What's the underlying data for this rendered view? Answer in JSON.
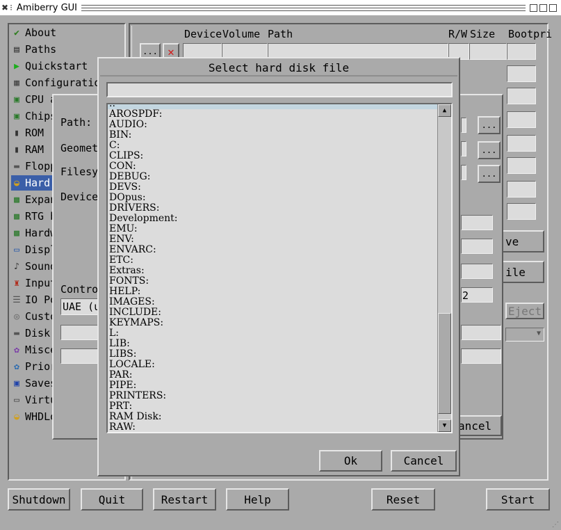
{
  "window": {
    "title": "Amiberry GUI"
  },
  "sidebar": {
    "items": [
      {
        "label": "About",
        "icon": "checkmark-icon"
      },
      {
        "label": "Paths",
        "icon": "paths-icon"
      },
      {
        "label": "Quickstart",
        "icon": "play-icon"
      },
      {
        "label": "Configurations",
        "icon": "config-icon"
      },
      {
        "label": "CPU and FPU",
        "icon": "cpu-icon"
      },
      {
        "label": "Chipset",
        "icon": "chip-icon"
      },
      {
        "label": "ROM",
        "icon": "rom-icon"
      },
      {
        "label": "RAM",
        "icon": "ram-icon"
      },
      {
        "label": "Floppy drives",
        "icon": "floppy-icon"
      },
      {
        "label": "Hard drives/CD",
        "icon": "harddrive-icon"
      },
      {
        "label": "Expansions",
        "icon": "expansion-icon"
      },
      {
        "label": "RTG board",
        "icon": "rtg-icon"
      },
      {
        "label": "Hardware info",
        "icon": "hardware-icon"
      },
      {
        "label": "Display",
        "icon": "display-icon"
      },
      {
        "label": "Sound",
        "icon": "sound-icon"
      },
      {
        "label": "Input",
        "icon": "joystick-icon"
      },
      {
        "label": "IO Ports",
        "icon": "ioports-icon"
      },
      {
        "label": "Custom controls",
        "icon": "gamepad-icon"
      },
      {
        "label": "Disk swapper",
        "icon": "disk-icon"
      },
      {
        "label": "Miscellaneous",
        "icon": "misc-icon"
      },
      {
        "label": "Priority",
        "icon": "priority-icon"
      },
      {
        "label": "Savestates",
        "icon": "save-icon"
      },
      {
        "label": "Virtual Keyboard",
        "icon": "keyboard-icon"
      },
      {
        "label": "WHDLoad",
        "icon": "whdload-icon"
      }
    ],
    "selected_index": 9
  },
  "main": {
    "columns": [
      "Device",
      "Volume",
      "Path",
      "R/W",
      "Size",
      "Bootpri"
    ],
    "row_buttons": {
      "ellipsis": "...",
      "delete": "✕"
    },
    "eject_label": "Eject",
    "save_label": "ve",
    "file_label": "ile"
  },
  "hardfile_dialog": {
    "path_label": "Path:",
    "geometry_label": "Geometr",
    "filesys_label": "Filesys",
    "device_label": "Device:",
    "controller_label": "Control",
    "controller_value": "UAE (u",
    "value_2": "2",
    "ellipsis": "...",
    "cancel_label": "ancel"
  },
  "file_dialog": {
    "title": "Select hard disk file",
    "path_value": "",
    "items": [
      "..",
      "AROSPDF:",
      "AUDIO:",
      "BIN:",
      "C:",
      "CLIPS:",
      "CON:",
      "DEBUG:",
      "DEVS:",
      "DOpus:",
      "DRIVERS:",
      "Development:",
      "EMU:",
      "ENV:",
      "ENVARC:",
      "ETC:",
      "Extras:",
      "FONTS:",
      "HELP:",
      "IMAGES:",
      "INCLUDE:",
      "KEYMAPS:",
      "L:",
      "LIB:",
      "LIBS:",
      "LOCALE:",
      "PAR:",
      "PIPE:",
      "PRINTERS:",
      "PRT:",
      "RAM Disk:",
      "RAW:"
    ],
    "ok_label": "Ok",
    "cancel_label": "Cancel"
  },
  "bottom_bar": {
    "shutdown": "Shutdown",
    "quit": "Quit",
    "restart": "Restart",
    "help": "Help",
    "reset": "Reset",
    "start": "Start"
  },
  "colors": {
    "background": "#aaaaaa",
    "selection": "#3b5fa8",
    "list_highlight": "#c3d6e0",
    "field": "#dcdcdc"
  }
}
